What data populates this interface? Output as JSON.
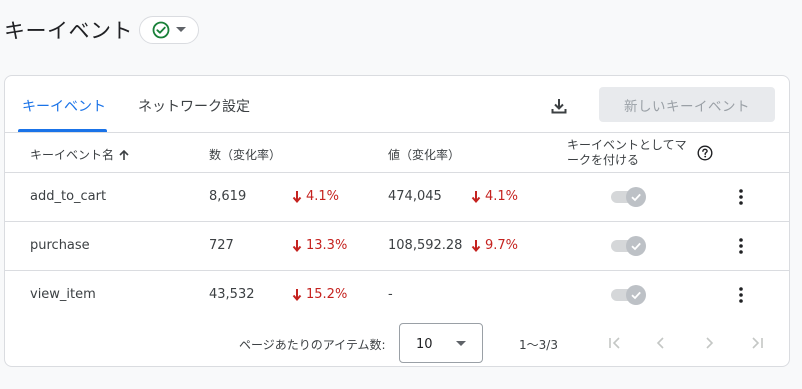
{
  "header": {
    "title": "キーイベント"
  },
  "tabs": [
    {
      "label": "キーイベント"
    },
    {
      "label": "ネットワーク設定"
    }
  ],
  "toolbar": {
    "new_event_label": "新しいキーイベント"
  },
  "table": {
    "headers": {
      "name": "キーイベント名",
      "count": "数（変化率）",
      "value": "値（変化率）",
      "mark": "キーイベントとしてマークを付ける"
    },
    "rows": [
      {
        "name": "add_to_cart",
        "count": "8,619",
        "count_change": "4.1%",
        "value": "474,045",
        "value_change": "4.1%",
        "marked": true
      },
      {
        "name": "purchase",
        "count": "727",
        "count_change": "13.3%",
        "value": "108,592.28",
        "value_change": "9.7%",
        "marked": true
      },
      {
        "name": "view_item",
        "count": "43,532",
        "count_change": "15.2%",
        "value": "-",
        "value_change": "",
        "marked": true
      }
    ]
  },
  "pagination": {
    "items_per_page_label": "ページあたりのアイテム数:",
    "items_per_page": "10",
    "range": "1〜3/3"
  },
  "colors": {
    "accent": "#1a73e8",
    "negative": "#c5221f",
    "success": "#188038"
  }
}
